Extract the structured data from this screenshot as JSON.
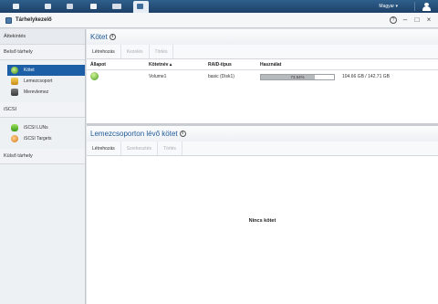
{
  "taskbar": {
    "icons": [
      "home-icon",
      "storage-icon",
      "settings-icon",
      "apps-icon",
      "fw-icon",
      "storage-manager-icon"
    ],
    "user_label": "Magyar ▾"
  },
  "window": {
    "title": "Tárhelykezelő",
    "help_label": "?",
    "minimize_label": "–",
    "maximize_label": "□",
    "close_label": "×"
  },
  "sidebar": {
    "overview": "Áttekintés",
    "internal": "Belső tárhely",
    "items": [
      {
        "label": "Kötet",
        "icon": "volume-icon"
      },
      {
        "label": "Lemezcsoport",
        "icon": "disk-group-icon"
      },
      {
        "label": "Merevlemez",
        "icon": "hdd-icon"
      }
    ],
    "iscsi": "iSCSI",
    "iscsi_items": [
      {
        "label": "iSCSI LUNs",
        "icon": "iscsi-lun-icon"
      },
      {
        "label": "iSCSI Targets",
        "icon": "iscsi-target-icon"
      }
    ],
    "external": "Külső tárhely"
  },
  "volume_panel": {
    "title": "Kötet",
    "buttons": [
      "Létrehozás",
      "Kezelés",
      "Törlés"
    ],
    "columns": [
      "Állapot",
      "Kötetnév ▴",
      "RAID-típus",
      "Használat"
    ],
    "rows": [
      {
        "status": "ok",
        "name": "Volume1",
        "raid": "basic (Disk1)",
        "usage_percent": 73.54,
        "usage_label": "73.54%",
        "capacity": "104.66 GB / 142.71 GB"
      }
    ]
  },
  "diskgroup_panel": {
    "title": "Lemezcsoporton lévő kötet",
    "buttons": [
      "Létrehozás",
      "Szerkesztés",
      "Törlés"
    ],
    "empty": "Nincs kötet"
  },
  "colors": {
    "taskbar": "#2a5580",
    "selected": "#1d5fa6",
    "title_blue": "#1f5a97"
  }
}
